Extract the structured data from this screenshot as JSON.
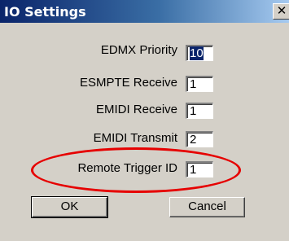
{
  "window": {
    "title": "IO Settings",
    "close_glyph": "✕"
  },
  "fields": [
    {
      "label": "EDMX Priority",
      "value": "10",
      "selected": true
    },
    {
      "label": "ESMPTE Receive",
      "value": "1",
      "selected": false
    },
    {
      "label": "EMIDI Receive",
      "value": "1",
      "selected": false
    },
    {
      "label": "EMIDI Transmit",
      "value": "2",
      "selected": false
    },
    {
      "label": "Remote Trigger ID",
      "value": "1",
      "selected": false
    }
  ],
  "buttons": {
    "ok": "OK",
    "cancel": "Cancel"
  },
  "annotation": {
    "shape": "ellipse",
    "color": "#e60000",
    "highlights": "Remote Trigger ID"
  }
}
